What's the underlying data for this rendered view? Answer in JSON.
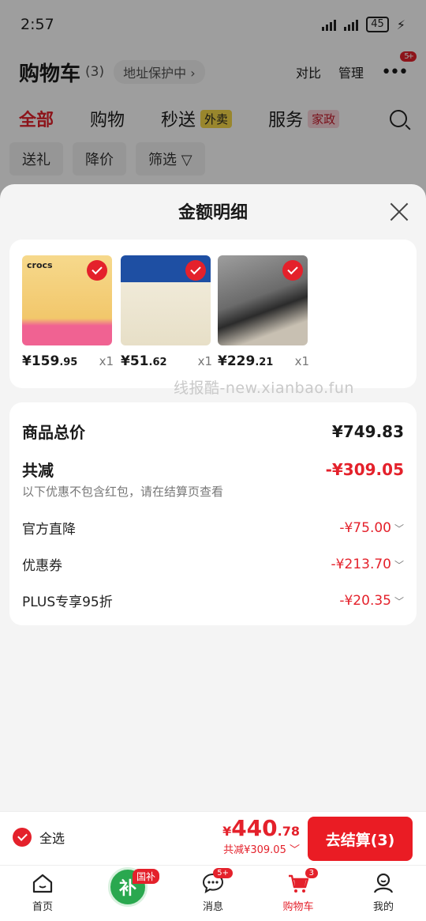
{
  "status": {
    "time": "2:57",
    "battery": "45"
  },
  "header": {
    "title": "购物车",
    "count": "(3)",
    "address": "地址保护中",
    "compare": "对比",
    "manage": "管理",
    "more_badge": "5+"
  },
  "top_tabs": [
    {
      "label": "全部"
    },
    {
      "label": "购物"
    },
    {
      "label": "秒送",
      "tag": "外卖"
    },
    {
      "label": "服务",
      "tag": "家政"
    }
  ],
  "chips": [
    "送礼",
    "降价",
    "筛选"
  ],
  "sheet": {
    "title": "金额明细",
    "products": [
      {
        "brand": "crocs",
        "price": "¥159",
        "price_dec": ".95",
        "qty": "x1"
      },
      {
        "price": "¥51",
        "price_dec": ".62",
        "qty": "x1"
      },
      {
        "price": "¥229",
        "price_dec": ".21",
        "qty": "x1"
      }
    ],
    "watermark": "线报酷-new.xianbao.fun",
    "total_label": "商品总价",
    "total_value": "¥749.83",
    "discount_label": "共减",
    "discount_value": "-¥309.05",
    "discount_note": "以下优惠不包含红包，请在结算页查看",
    "items": [
      {
        "label": "官方直降",
        "value": "-¥75.00"
      },
      {
        "label": "优惠券",
        "value": "-¥213.70"
      },
      {
        "label": "PLUS专享95折",
        "value": "-¥20.35"
      }
    ]
  },
  "checkout": {
    "select_all": "全选",
    "currency": "¥",
    "total_int": "440",
    "total_dec": ".78",
    "saved": "共减¥309.05",
    "button": "去结算(3)"
  },
  "tabbar": {
    "home": "首页",
    "subsidy_icon": "补",
    "subsidy_tag": "国补",
    "messages": "消息",
    "messages_badge": "5+",
    "cart": "购物车",
    "cart_badge": "3",
    "me": "我的"
  },
  "colors": {
    "accent": "#e4212b",
    "subsidy_green": "#2aa84f"
  }
}
